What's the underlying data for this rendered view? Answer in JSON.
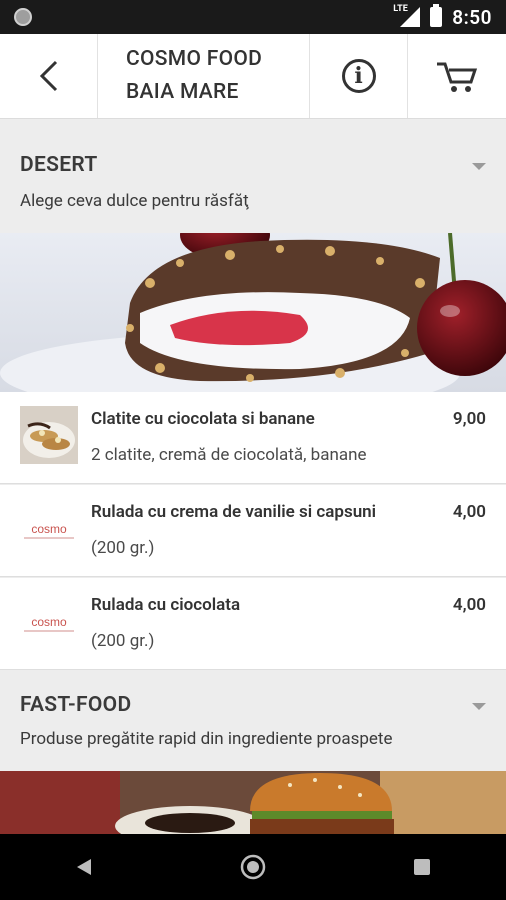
{
  "status": {
    "time": "8:50",
    "network": "LTE"
  },
  "header": {
    "title": "COSMO FOOD\nBAIA MARE",
    "icons": [
      "back-arrow-icon",
      "info-icon",
      "cart-icon"
    ]
  },
  "sections": [
    {
      "title": "DESERT",
      "subtitle": "Alege ceva dulce pentru răsfăţ",
      "items": [
        {
          "name": "Clatite cu ciocolata si banane",
          "description": "2 clatite, cremă de ciocolată, banane",
          "price": "9,00",
          "image": "pancake-thumbnail"
        },
        {
          "name": "Rulada cu crema de vanilie si capsuni",
          "description": "(200 gr.)",
          "price": "4,00",
          "image": "cosmo-logo"
        },
        {
          "name": "Rulada cu ciocolata",
          "description": "(200 gr.)",
          "price": "4,00",
          "image": "cosmo-logo"
        }
      ]
    },
    {
      "title": "FAST-FOOD",
      "subtitle": "Produse pregătite rapid din ingrediente proaspete",
      "items": []
    }
  ],
  "logo_text": "cosmo",
  "colors": {
    "appbar": "#ffffff",
    "background": "#ededed",
    "statusbar": "#1a1a1a",
    "navbar": "#000000",
    "logo": "#c9544f"
  }
}
